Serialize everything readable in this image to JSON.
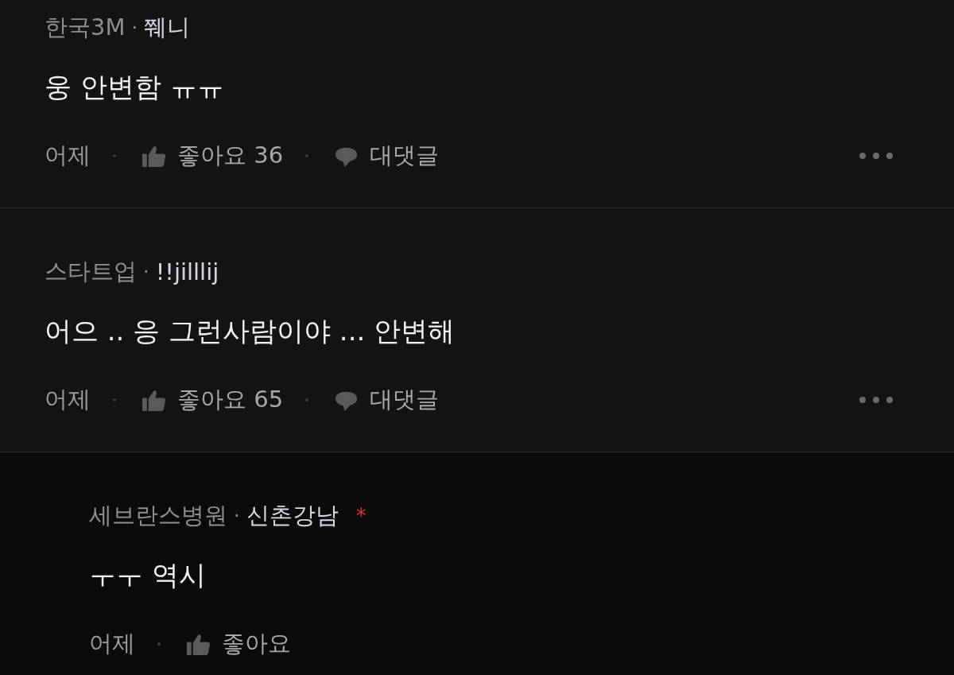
{
  "comments": [
    {
      "kind": "comment",
      "company": "한국3M",
      "separator": "·",
      "author": "쮀니",
      "text": "웅 안변함 ㅠㅠ",
      "time": "어제",
      "like_label": "좋아요",
      "like_count": "36",
      "reply_label": "대댓글",
      "more": true
    },
    {
      "kind": "comment",
      "company": "스타트업",
      "separator": "·",
      "author": "!!jilllij",
      "text": "어으 .. 응 그런사람이야 ... 안변해",
      "time": "어제",
      "like_label": "좋아요",
      "like_count": "65",
      "reply_label": "대댓글",
      "more": true
    },
    {
      "kind": "reply",
      "company": "세브란스병원",
      "separator": "·",
      "author": "신촌강남",
      "author_badge": "*",
      "text": "ㅜㅜ 역시",
      "time": "어제",
      "like_label": "좋아요"
    }
  ]
}
